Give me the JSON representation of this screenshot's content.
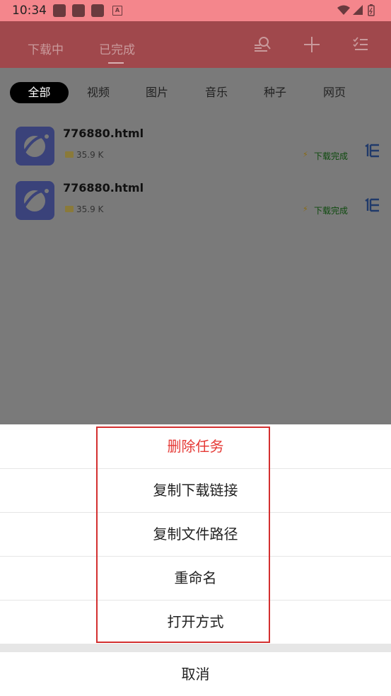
{
  "status_bar": {
    "time": "10:34",
    "notif_letter": "A"
  },
  "app_bar": {
    "tabs": [
      {
        "label": "下载中"
      },
      {
        "label": "已完成"
      }
    ],
    "icons": [
      "search-list-icon",
      "plus-icon",
      "checklist-icon"
    ]
  },
  "filters": [
    {
      "label": "全部",
      "active": true
    },
    {
      "label": "视频"
    },
    {
      "label": "图片"
    },
    {
      "label": "音乐"
    },
    {
      "label": "种子"
    },
    {
      "label": "网页"
    }
  ],
  "downloads": [
    {
      "name": "776880.html",
      "size": "35.9 K",
      "status": "下载完成"
    },
    {
      "name": "776880.html",
      "size": "35.9 K",
      "status": "下载完成"
    }
  ],
  "sheet": {
    "items": [
      {
        "label": "删除任务"
      },
      {
        "label": "复制下载链接"
      },
      {
        "label": "复制文件路径"
      },
      {
        "label": "重命名"
      },
      {
        "label": "打开方式"
      }
    ],
    "cancel": "取消"
  },
  "colors": {
    "status_bar": "#f4868c",
    "app_bar": "#a0484c",
    "danger": "#e53935",
    "highlight": "#d32f2f"
  }
}
